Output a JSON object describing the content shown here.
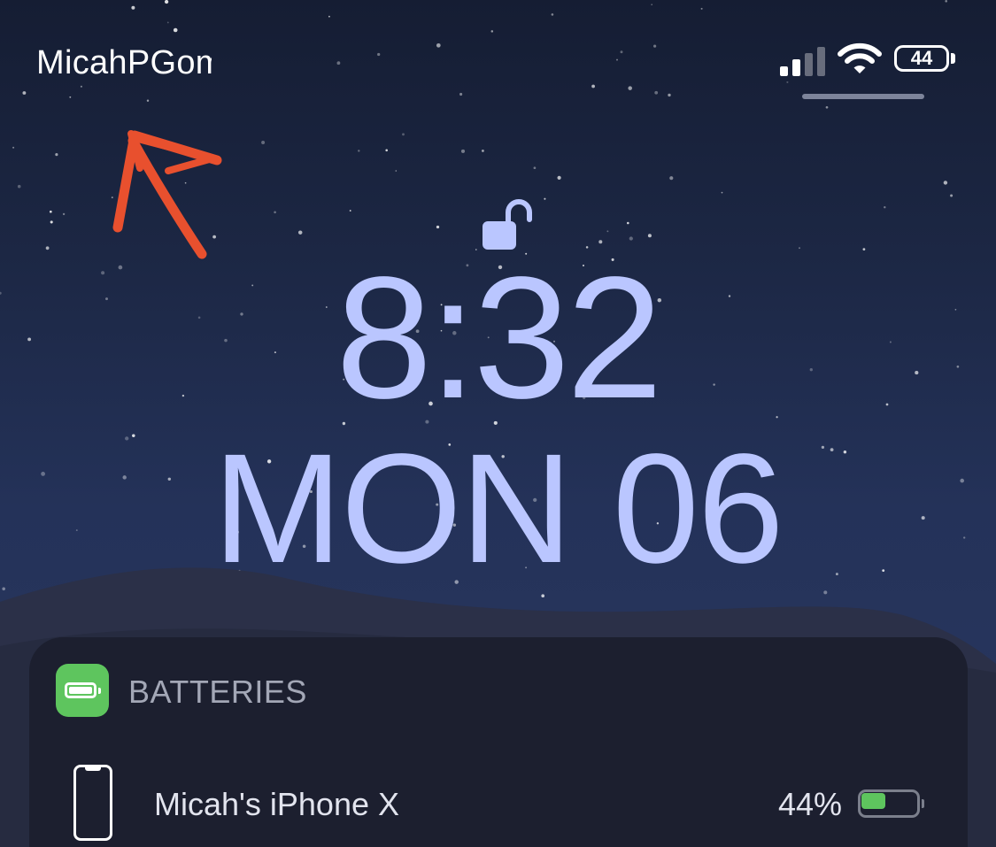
{
  "status_bar": {
    "carrier": "MicahPGomez",
    "signal_bars_active": 2,
    "signal_bars_total": 4,
    "battery_level": "44"
  },
  "lock_screen": {
    "time": "8:32",
    "date": "MON 06"
  },
  "widget": {
    "title": "BATTERIES",
    "devices": [
      {
        "name": "Micah's iPhone X",
        "percent": "44%",
        "level": 0.44
      }
    ]
  },
  "icons": {
    "signal": "cellular-signal-icon",
    "wifi": "wifi-icon",
    "battery": "battery-icon",
    "lock": "unlocked-padlock-icon",
    "widget": "batteries-widget-icon",
    "device": "iphone-icon",
    "annotation": "hand-drawn-arrow"
  },
  "colors": {
    "time_text": "#bac6ff",
    "annotation": "#e8502e",
    "battery_green": "#5ec55e",
    "widget_bg": "#1c1f2e"
  }
}
